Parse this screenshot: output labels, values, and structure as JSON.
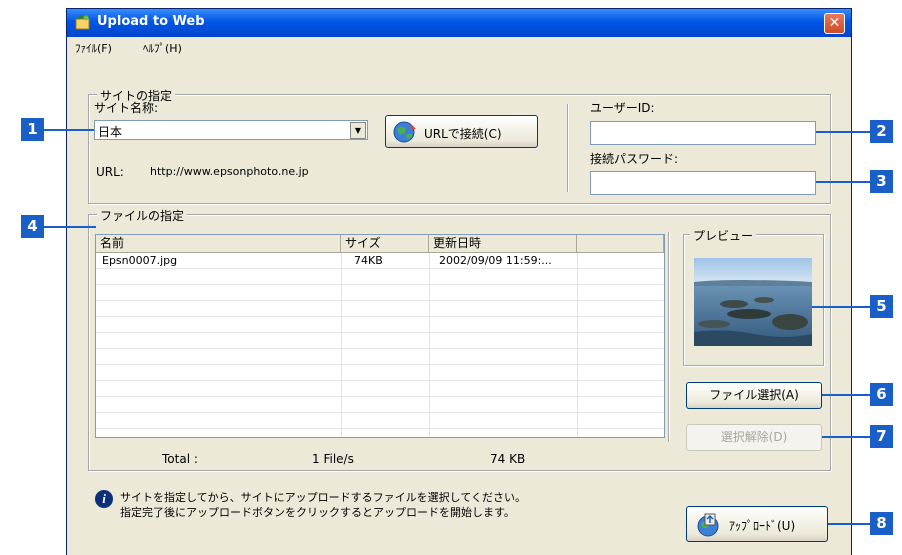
{
  "window": {
    "title": "Upload to Web",
    "close_glyph": "✕"
  },
  "menu": [
    "ﾌｧｲﾙ(F)",
    "ﾍﾙﾌﾟ(H)"
  ],
  "site": {
    "group_label": "サイトの指定",
    "name_label": "サイト名称:",
    "name_value": "日本",
    "connect_button": "URLで接続(C)",
    "url_label": "URL:",
    "url_value": "http://www.epsonphoto.ne.jp",
    "user_id_label": "ユーザーID:",
    "user_id_value": "",
    "password_label": "接続パスワード:",
    "password_value": ""
  },
  "files": {
    "group_label": "ファイルの指定",
    "columns": [
      "名前",
      "サイズ",
      "更新日時",
      ""
    ],
    "rows": [
      [
        "Epsn0007.jpg",
        "74KB",
        "2002/09/09 11:59:..."
      ]
    ],
    "total_label": "Total :",
    "total_files": "1  File/s",
    "total_size": "74  KB"
  },
  "preview": {
    "label": "プレビュー"
  },
  "buttons": {
    "select_file": "ファイル選択(A)",
    "deselect": "選択解除(D)",
    "upload": "ｱｯﾌﾟﾛｰﾄﾞ(U)"
  },
  "info_text_line1": "サイトを指定してから、サイトにアップロードするファイルを選択してください。",
  "info_text_line2": "指定完了後にアップロードボタンをクリックするとアップロードを開始します。",
  "callouts": [
    "1",
    "2",
    "3",
    "4",
    "5",
    "6",
    "7",
    "8"
  ],
  "colors": {
    "callout": "#1a5fc8",
    "titlebar": "#0055e5",
    "window_bg": "#ece9d8"
  }
}
